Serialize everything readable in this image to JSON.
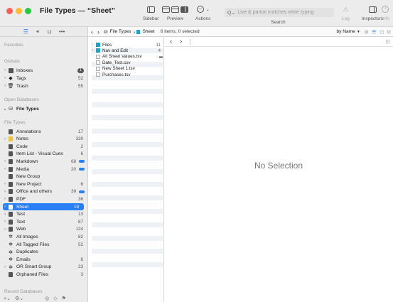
{
  "window": {
    "title": "File Types — “Sheet”"
  },
  "toolbar": {
    "sidebar_label": "Sidebar",
    "preview_label": "Preview",
    "actions_label": "Actions",
    "search_label": "Search",
    "search_placeholder": "Live & partial matches while typing",
    "log_label": "Log",
    "inspectors_label": "Inspectors",
    "info_label": "Info"
  },
  "sidebar": {
    "favorites_heading": "Favorites",
    "globals_heading": "Globals",
    "globals": [
      {
        "label": "Inboxes",
        "count": "1"
      },
      {
        "label": "Tags",
        "count": "52"
      },
      {
        "label": "Trash",
        "count": "55"
      }
    ],
    "open_databases_heading": "Open Databases",
    "open_database": "File Types",
    "file_types_heading": "File Types",
    "items": [
      {
        "label": "Annotations",
        "count": "17"
      },
      {
        "label": "Notes",
        "count": "330"
      },
      {
        "label": "Code",
        "count": "2"
      },
      {
        "label": "Item List - Visual Cues",
        "count": "6"
      },
      {
        "label": "Markdown",
        "count": "68"
      },
      {
        "label": "Media",
        "count": "20"
      },
      {
        "label": "New Group",
        "count": ""
      },
      {
        "label": "New Project",
        "count": "6"
      },
      {
        "label": "Office and others",
        "count": "39"
      },
      {
        "label": "PDF",
        "count": "36"
      },
      {
        "label": "Sheet",
        "count": "19"
      },
      {
        "label": "Test",
        "count": "13"
      },
      {
        "label": "Text",
        "count": "87"
      },
      {
        "label": "Web",
        "count": "124"
      },
      {
        "label": "All Images",
        "count": "82"
      },
      {
        "label": "All Tagged Files",
        "count": "52"
      },
      {
        "label": "Duplicates",
        "count": ""
      },
      {
        "label": "Emails",
        "count": "8"
      },
      {
        "label": "OR Smart Group",
        "count": "23"
      },
      {
        "label": "Orphaned Files",
        "count": "3"
      }
    ],
    "recent_heading": "Recent Databases"
  },
  "list_header": {
    "breadcrumb_db": "File Types",
    "breadcrumb_group": "Sheet",
    "status": "6 items, 0 selected",
    "sort": "by Name"
  },
  "list": {
    "rows": [
      {
        "label": "Files",
        "count": "11"
      },
      {
        "label": "Nav and Edit",
        "count": "4"
      },
      {
        "label": "All Sheet Values.tsv",
        "count": ""
      },
      {
        "label": "Date_Test.csv",
        "count": ""
      },
      {
        "label": "New Sheet 1.tsv",
        "count": ""
      },
      {
        "label": "Purchases.tsv",
        "count": ""
      }
    ]
  },
  "detail": {
    "empty_text": "No Selection"
  },
  "colors": {
    "accent": "#2a7ff5",
    "close": "#fe5f57",
    "minimize": "#febc2e",
    "zoom": "#28c840"
  }
}
